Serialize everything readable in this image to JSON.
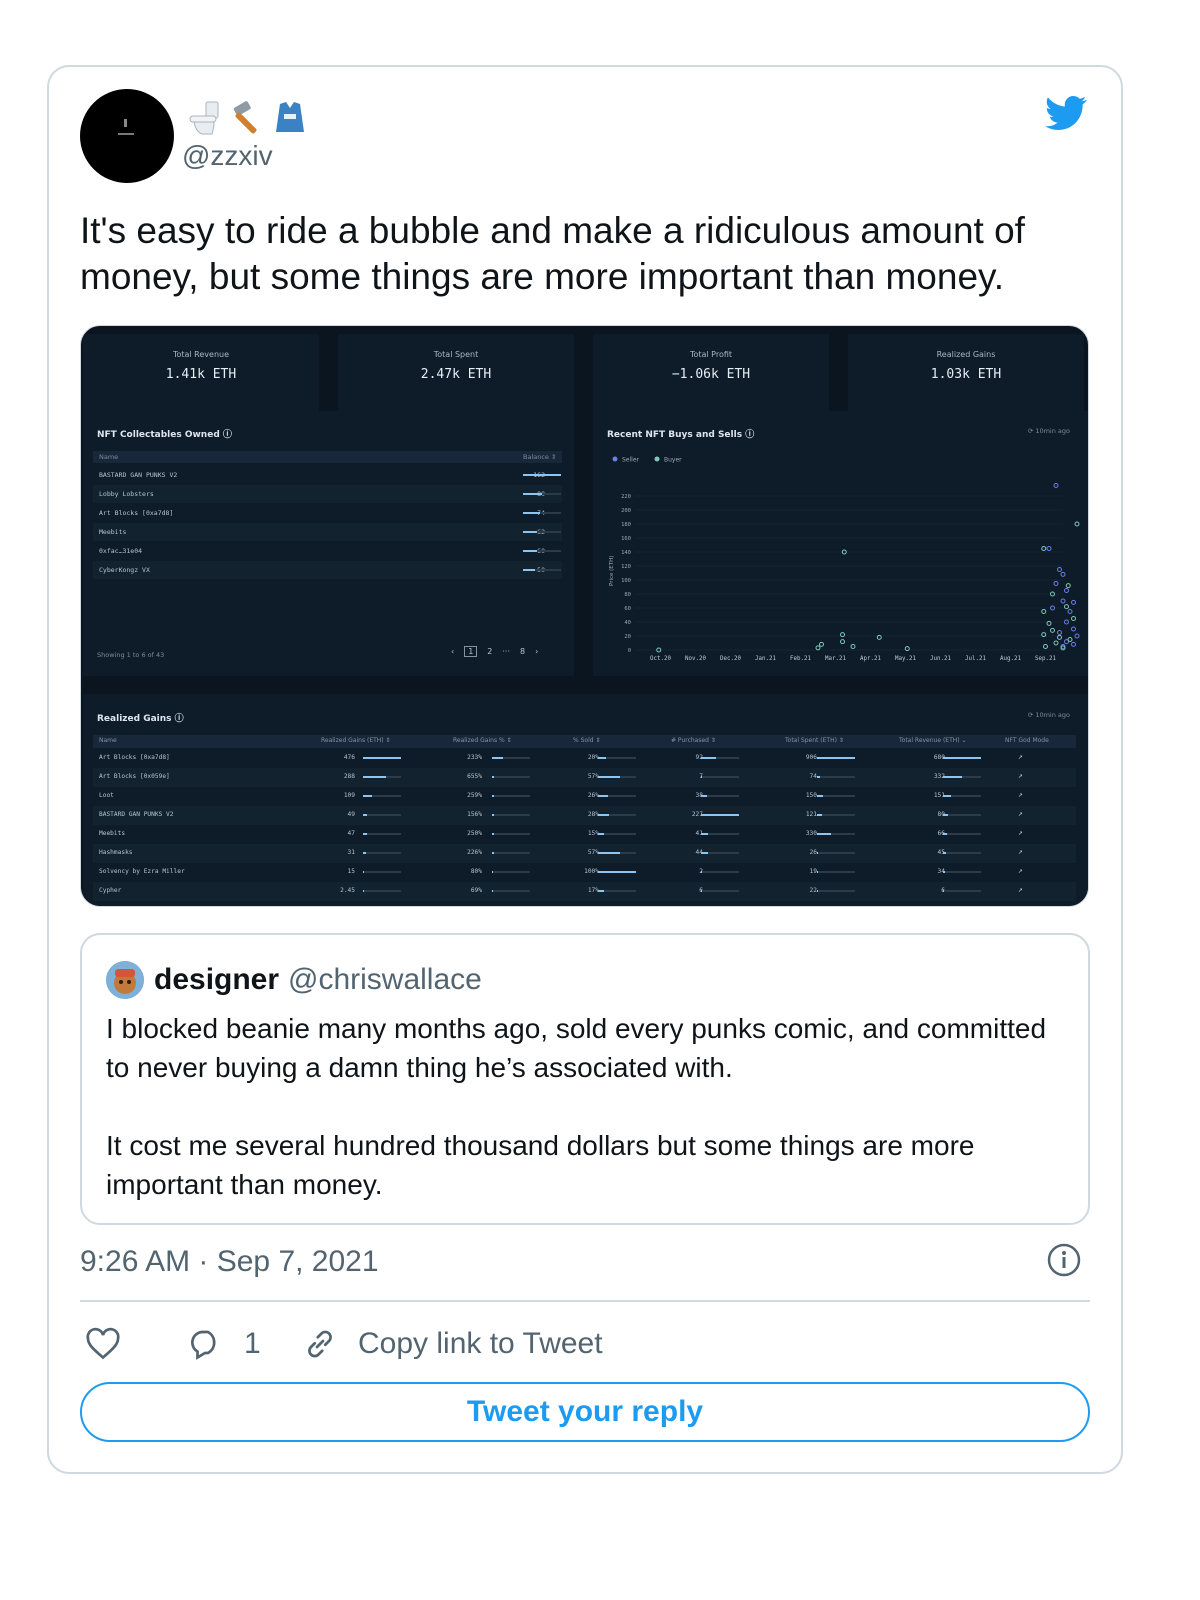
{
  "author": {
    "handle": "@zzxiv",
    "display_emojis": [
      "toilet-icon",
      "hammer-icon",
      "lab-coat-icon"
    ]
  },
  "tweet": {
    "text": "It's easy to ride a bubble and make a ridiculous amount of money, but some things are more important than money.",
    "timestamp": "9:26 AM · Sep 7, 2021",
    "reply_count": "1",
    "copy_link_label": "Copy link to Tweet",
    "reply_button_label": "Tweet your reply"
  },
  "dashboard": {
    "stats": [
      {
        "label": "Total Revenue",
        "value": "1.41k ETH"
      },
      {
        "label": "Total Spent",
        "value": "2.47k ETH"
      },
      {
        "label": "Total Profit",
        "value": "−1.06k ETH"
      },
      {
        "label": "Realized Gains",
        "value": "1.03k ETH"
      }
    ],
    "owned": {
      "title": "NFT Collectables Owned",
      "col_name": "Name",
      "col_balance": "Balance ⇕",
      "rows": [
        {
          "name": "BASTARD GAN PUNKS V2",
          "balance": "162",
          "fill": 1.0
        },
        {
          "name": "Lobby Lobsters",
          "balance": "80",
          "fill": 0.5
        },
        {
          "name": "Art Blocks [0xa7d8]",
          "balance": "74",
          "fill": 0.46
        },
        {
          "name": "Meebits",
          "balance": "62",
          "fill": 0.38
        },
        {
          "name": "0xfac…31e04",
          "balance": "60",
          "fill": 0.37
        },
        {
          "name": "CyberKongz VX",
          "balance": "50",
          "fill": 0.31
        }
      ],
      "footer": "Showing 1 to 6 of 43",
      "pager": {
        "prev": "‹",
        "current": "1",
        "p2": "2",
        "ellipsis": "···",
        "last": "8",
        "next": "›"
      }
    },
    "chart_data": {
      "type": "scatter",
      "title": "Recent NFT Buys and Sells",
      "updated": "10min ago",
      "ylabel": "Price (ETH)",
      "ylim": [
        0,
        230
      ],
      "yticks": [
        "220",
        "200",
        "180",
        "160",
        "140",
        "120",
        "100",
        "80",
        "60",
        "40",
        "20",
        "0"
      ],
      "xticks": [
        "Oct.20",
        "Nov.20",
        "Dec.20",
        "Jan.21",
        "Feb.21",
        "Mar.21",
        "Apr.21",
        "May.21",
        "Jun.21",
        "Jul.21",
        "Aug.21",
        "Sep.21"
      ],
      "legend": [
        "Seller",
        "Buyer"
      ],
      "series": [
        {
          "name": "Seller",
          "color": "#6b7fe8",
          "points": [
            [
              11.3,
              235
            ],
            [
              11.1,
              145
            ],
            [
              11.4,
              115
            ],
            [
              11.5,
              108
            ],
            [
              11.3,
              95
            ],
            [
              11.6,
              85
            ],
            [
              11.8,
              68
            ],
            [
              11.5,
              70
            ],
            [
              11.2,
              60
            ],
            [
              11.7,
              55
            ],
            [
              11.6,
              40
            ],
            [
              11.8,
              30
            ],
            [
              11.4,
              25
            ],
            [
              11.9,
              20
            ],
            [
              11.6,
              12
            ],
            [
              11.8,
              8
            ],
            [
              11.5,
              5
            ]
          ]
        },
        {
          "name": "Buyer",
          "color": "#7ec9b8",
          "points": [
            [
              -0.05,
              0
            ],
            [
              5.25,
              140
            ],
            [
              5.2,
              22
            ],
            [
              4.6,
              8
            ],
            [
              4.5,
              3
            ],
            [
              5.2,
              12
            ],
            [
              5.5,
              5
            ],
            [
              6.25,
              18
            ],
            [
              7.05,
              2
            ],
            [
              10.95,
              145
            ],
            [
              11.9,
              180
            ],
            [
              10.95,
              55
            ],
            [
              11.1,
              38
            ],
            [
              11.2,
              28
            ],
            [
              10.95,
              22
            ],
            [
              11.4,
              18
            ],
            [
              11.3,
              10
            ],
            [
              11.7,
              15
            ],
            [
              11.0,
              5
            ],
            [
              11.5,
              3
            ],
            [
              11.2,
              80
            ],
            [
              11.65,
              92
            ],
            [
              11.8,
              45
            ],
            [
              11.6,
              62
            ]
          ]
        }
      ]
    },
    "gains": {
      "title": "Realized Gains",
      "updated": "10min ago",
      "headers": [
        "Name",
        "Realized Gains (ETH) ⇕",
        "Realized Gains % ⇕",
        "% Sold ⇕",
        "# Purchased ⇕",
        "Total Spent (ETH) ⇕",
        "Total Revenue (ETH) ⌄",
        "NFT God Mode"
      ],
      "rows": [
        {
          "name": "Art Blocks [0xa7d8]",
          "gains": "476",
          "gpct": "233%",
          "sold": "20%",
          "purchased": "92",
          "spent": "906",
          "revenue": "680",
          "f": [
            1.0,
            0.3,
            0.2,
            0.4,
            1.0,
            1.0
          ]
        },
        {
          "name": "Art Blocks [0x059e]",
          "gains": "288",
          "gpct": "655%",
          "sold": "57%",
          "purchased": "7",
          "spent": "74",
          "revenue": "332",
          "f": [
            0.6,
            0.05,
            0.57,
            0.03,
            0.08,
            0.49
          ]
        },
        {
          "name": "Loot",
          "gains": "109",
          "gpct": "259%",
          "sold": "26%",
          "purchased": "38",
          "spent": "150",
          "revenue": "151",
          "f": [
            0.23,
            0.05,
            0.26,
            0.17,
            0.17,
            0.22
          ]
        },
        {
          "name": "BASTARD GAN PUNKS V2",
          "gains": "49",
          "gpct": "156%",
          "sold": "28%",
          "purchased": "227",
          "spent": "121",
          "revenue": "80",
          "f": [
            0.1,
            0.04,
            0.28,
            1.0,
            0.13,
            0.12
          ]
        },
        {
          "name": "Meebits",
          "gains": "47",
          "gpct": "250%",
          "sold": "15%",
          "purchased": "41",
          "spent": "330",
          "revenue": "66",
          "f": [
            0.1,
            0.05,
            0.15,
            0.18,
            0.36,
            0.1
          ]
        },
        {
          "name": "Hashmasks",
          "gains": "31",
          "gpct": "226%",
          "sold": "57%",
          "purchased": "44",
          "spent": "26",
          "revenue": "45",
          "f": [
            0.07,
            0.04,
            0.57,
            0.19,
            0.03,
            0.07
          ]
        },
        {
          "name": "Solvency by Ezra Miller",
          "gains": "15",
          "gpct": "80%",
          "sold": "100%",
          "purchased": "2",
          "spent": "19",
          "revenue": "34",
          "f": [
            0.03,
            0.02,
            1.0,
            0.01,
            0.02,
            0.05
          ]
        },
        {
          "name": "Cypher",
          "gains": "2.45",
          "gpct": "69%",
          "sold": "17%",
          "purchased": "6",
          "spent": "22",
          "revenue": "6",
          "f": [
            0.01,
            0.02,
            0.17,
            0.03,
            0.02,
            0.01
          ]
        }
      ]
    }
  },
  "quote": {
    "name": "designer",
    "handle": "@chriswallace",
    "text_p1": "I blocked beanie many months ago, sold every punks comic, and committed to never buying a damn thing he’s associated with.",
    "text_p2": "It cost me several hundred thousand dollars but some things are more important than money."
  },
  "colors": {
    "accent": "#1d9bf0",
    "secondary_text": "#536471",
    "dashboard_bg": "#0a1520"
  }
}
